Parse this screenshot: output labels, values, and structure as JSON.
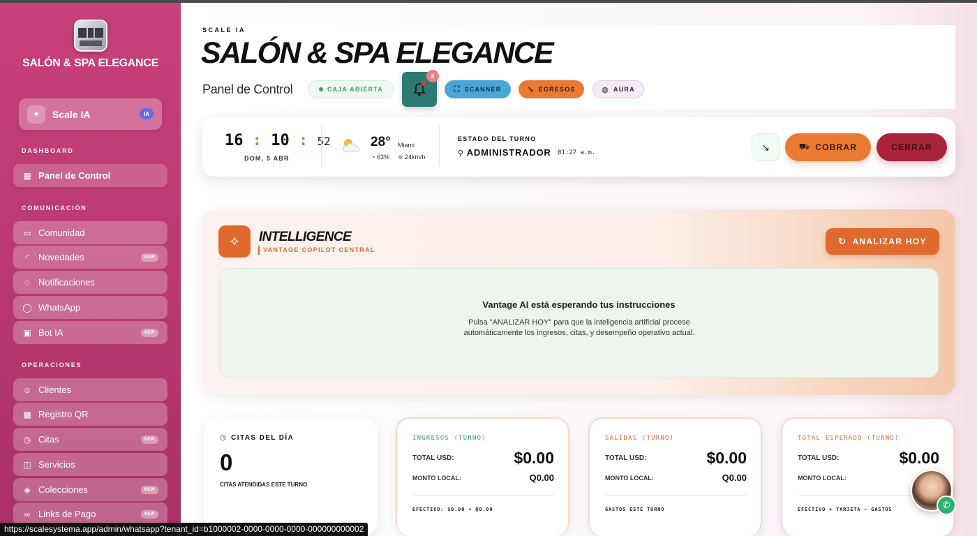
{
  "sidebar": {
    "brand": "SALÓN & SPA ELEGANCE",
    "scale_button": {
      "label": "Scale IA",
      "badge": "IA"
    },
    "sections": [
      {
        "title": "DASHBOARD"
      },
      {
        "title": "COMUNICACIÓN"
      },
      {
        "title": "OPERACIONES"
      }
    ],
    "items": [
      {
        "label": "Panel de Control",
        "icon": "grid-icon"
      },
      {
        "label": "Comunidad",
        "icon": "chat-icon"
      },
      {
        "label": "Novedades",
        "icon": "rss-icon",
        "badge": "NEW"
      },
      {
        "label": "Notificaciones",
        "icon": "bell-icon"
      },
      {
        "label": "WhatsApp",
        "icon": "whatsapp-icon"
      },
      {
        "label": "Bot IA",
        "icon": "bot-icon",
        "badge": "NEW"
      },
      {
        "label": "Clientes",
        "icon": "users-icon"
      },
      {
        "label": "Registro QR",
        "icon": "qr-icon"
      },
      {
        "label": "Citas",
        "icon": "clock-icon",
        "badge": "NEW"
      },
      {
        "label": "Servicios",
        "icon": "bag-icon"
      },
      {
        "label": "Colecciones",
        "icon": "layers-icon",
        "badge": "NEW"
      },
      {
        "label": "Links de Pago",
        "icon": "link-icon",
        "badge": "NEW"
      }
    ]
  },
  "header": {
    "kicker": "SCALE IA",
    "title": "SALÓN & SPA ELEGANCE",
    "subtitle": "Panel de Control",
    "caja_chip": "CAJA ABIERTA",
    "bell_count": "8",
    "scanner_label": "SCANNER",
    "egresos_label": "EGRESOS",
    "aura_label": "AURA"
  },
  "status": {
    "hour": "16",
    "minute": "10",
    "second": "52",
    "date": "DOM, 5 ABR",
    "temp": "28°",
    "city": "Miami",
    "humidity": "63%",
    "wind": "24km/h",
    "shift_label": "ESTADO DEL TURNO",
    "shift_user": "ADMINISTRADOR",
    "shift_time": "01:27 a.m.",
    "cobrar_label": "COBRAR",
    "cerrar_label": "CERRAR"
  },
  "intelligence": {
    "title": "INTELLIGENCE",
    "subtitle": "VANTAGE COPILOT CENTRAL",
    "analyze_label": "ANALIZAR HOY",
    "wait_title": "Vantage AI está esperando tus instrucciones",
    "wait_text": "Pulsa \"ANALIZAR HOY\" para que la inteligencia artificial procese automáticamente los ingresos, citas, y desempeño operativo actual."
  },
  "stats": {
    "citas": {
      "label": "CITAS DEL DÍA",
      "value": "0",
      "sub": "CITAS ATENDIDAS ESTE TURNO"
    },
    "ingresos": {
      "head": "INGRESOS (TURNO)",
      "usd_label": "TOTAL USD:",
      "usd": "$0.00",
      "local_label": "MONTO LOCAL:",
      "local": "Q0.00",
      "foot": "EFECTIVO: $0.00 + Q0.00"
    },
    "salidas": {
      "head": "SALIDAS (TURNO)",
      "usd_label": "TOTAL USD:",
      "usd": "$0.00",
      "local_label": "MONTO LOCAL:",
      "local": "Q0.00",
      "foot": "GASTOS ESTE TURNO"
    },
    "esperado": {
      "head": "TOTAL ESPERADO (TURNO)",
      "usd_label": "TOTAL USD:",
      "usd": "$0.00",
      "local_label": "MONTO LOCAL:",
      "foot": "EFECTIVO + TARJETA − GASTOS"
    }
  },
  "statusbar_url": "https://scalesystema.app/admin/whatsapp?tenant_id=b1000002-0000-0000-0000-000000000002",
  "colors": {
    "sidebar": "#c9407a",
    "accent_orange": "#e0692e",
    "cerrar": "#a8243b",
    "scanner": "#4aa6d6",
    "bell": "#2b7a73"
  }
}
